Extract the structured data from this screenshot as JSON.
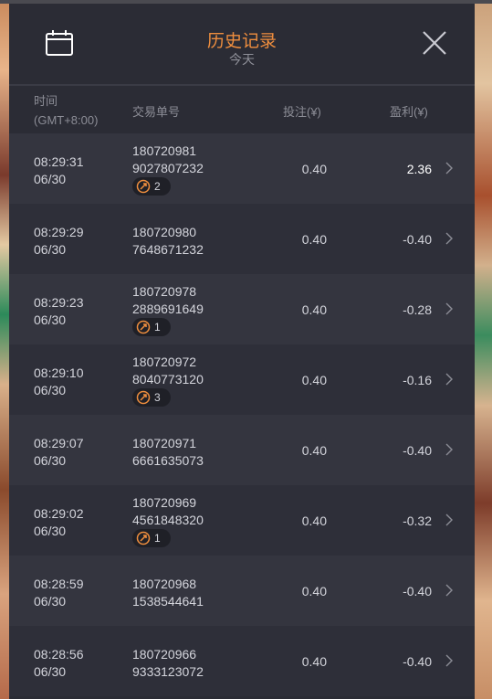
{
  "header": {
    "title": "历史记录",
    "subtitle": "今天"
  },
  "columns": {
    "time": "时间",
    "timezone": "(GMT+8:00)",
    "order_id": "交易单号",
    "bet": "投注(¥)",
    "profit": "盈利(¥)"
  },
  "rows": [
    {
      "time": "08:29:31",
      "date": "06/30",
      "id1": "180720981",
      "id2": "9027807232",
      "badge": "2",
      "bet": "0.40",
      "profit": "2.36"
    },
    {
      "time": "08:29:29",
      "date": "06/30",
      "id1": "180720980",
      "id2": "7648671232",
      "badge": null,
      "bet": "0.40",
      "profit": "-0.40"
    },
    {
      "time": "08:29:23",
      "date": "06/30",
      "id1": "180720978",
      "id2": "2889691649",
      "badge": "1",
      "bet": "0.40",
      "profit": "-0.28"
    },
    {
      "time": "08:29:10",
      "date": "06/30",
      "id1": "180720972",
      "id2": "8040773120",
      "badge": "3",
      "bet": "0.40",
      "profit": "-0.16"
    },
    {
      "time": "08:29:07",
      "date": "06/30",
      "id1": "180720971",
      "id2": "6661635073",
      "badge": null,
      "bet": "0.40",
      "profit": "-0.40"
    },
    {
      "time": "08:29:02",
      "date": "06/30",
      "id1": "180720969",
      "id2": "4561848320",
      "badge": "1",
      "bet": "0.40",
      "profit": "-0.32"
    },
    {
      "time": "08:28:59",
      "date": "06/30",
      "id1": "180720968",
      "id2": "1538544641",
      "badge": null,
      "bet": "0.40",
      "profit": "-0.40"
    },
    {
      "time": "08:28:56",
      "date": "06/30",
      "id1": "180720966",
      "id2": "9333123072",
      "badge": null,
      "bet": "0.40",
      "profit": "-0.40"
    }
  ],
  "colors": {
    "accent": "#ef8e3e",
    "panel": "#2b2c35",
    "row_odd": "#34353f",
    "row_even": "#2e2f39"
  }
}
